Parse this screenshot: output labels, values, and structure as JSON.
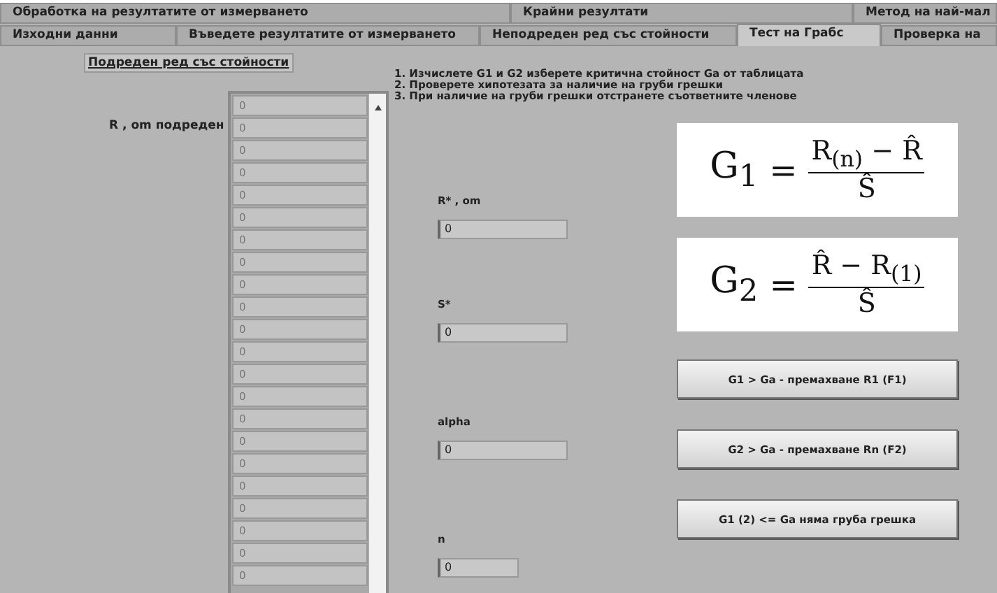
{
  "tab_rows": [
    {
      "tabs": [
        {
          "label": "Обработка на резултатите от измерването",
          "selected": false
        },
        {
          "label": "Крайни резултати",
          "selected": false
        },
        {
          "label": "Метод на най-мал",
          "selected": false
        }
      ]
    },
    {
      "tabs": [
        {
          "label": "Изходни данни",
          "selected": false
        },
        {
          "label": "Въведете резултатите от измерването",
          "selected": false
        },
        {
          "label": "Неподреден ред със стойности",
          "selected": false
        },
        {
          "label": "Тест на Грабс",
          "selected": true
        },
        {
          "label": "Проверка на",
          "selected": false
        }
      ]
    }
  ],
  "section_label": "Подреден ред със стойности",
  "array_label": "R , om подреден",
  "array_values": [
    "0",
    "0",
    "0",
    "0",
    "0",
    "0",
    "0",
    "0",
    "0",
    "0",
    "0",
    "0",
    "0",
    "0",
    "0",
    "0",
    "0",
    "0",
    "0",
    "0",
    "0",
    "0"
  ],
  "instructions": [
    "1. Изчислете G1 и G2 изберете критична стойност Ga от таблицата",
    "2. Проверете хипотезата за наличие на груби грешки",
    "3. При наличие на груби грешки отстранете съответните членове"
  ],
  "fields": [
    {
      "label": "R* , om",
      "value": "0",
      "kind": "wide"
    },
    {
      "label": "S*",
      "value": "0",
      "kind": "wide"
    },
    {
      "label": "alpha",
      "value": "0",
      "kind": "wide"
    },
    {
      "label": "n",
      "value": "0",
      "kind": "narrow"
    }
  ],
  "formulas": [
    {
      "lhs": "G$_{1}$",
      "eq": "=",
      "numerator": "R$_{(n)}$ − R̂",
      "denominator": "Ŝ"
    },
    {
      "lhs": "G$_{2}$",
      "eq": "=",
      "numerator": "R̂ − R$_{(1)}$",
      "denominator": "Ŝ"
    }
  ],
  "buttons": [
    "G1 > Ga - премахване R1 (F1)",
    "G2 > Ga - премахване Rn (F2)",
    "G1 (2) <= Ga няма груба грешка"
  ]
}
